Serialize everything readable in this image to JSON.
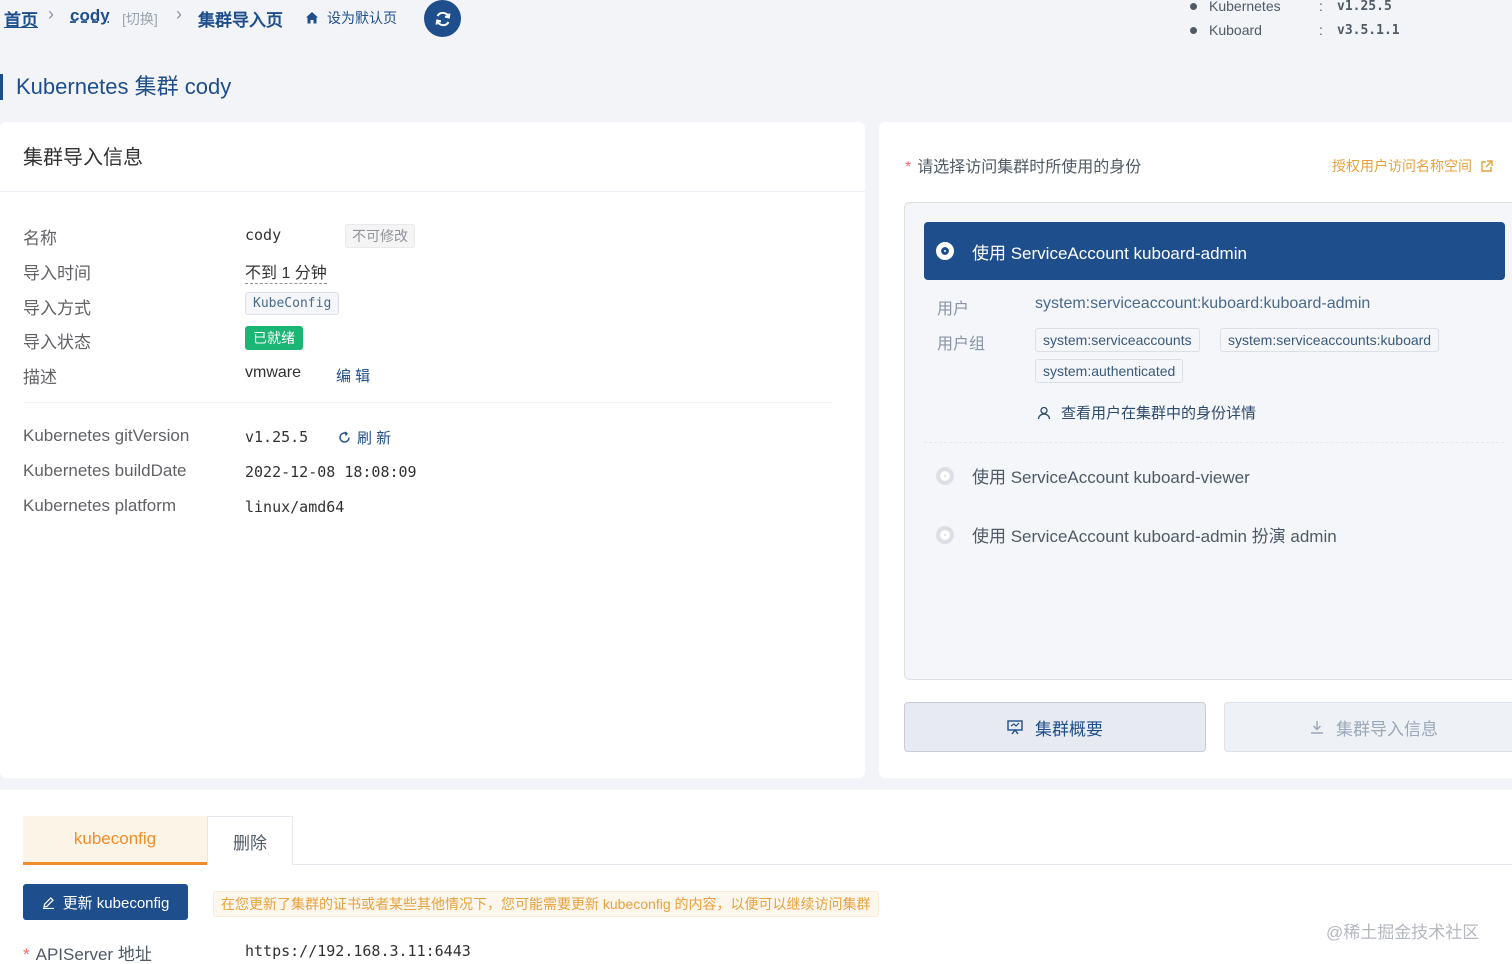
{
  "breadcrumb": {
    "home": "首页",
    "cluster": "cody",
    "switch": "[切换]",
    "current": "集群导入页",
    "set_default": "设为默认页"
  },
  "versions": [
    {
      "name": "Kubernetes",
      "sep": ":",
      "value": "v1.25.5"
    },
    {
      "name": "Kuboard",
      "sep": ":",
      "value": "v3.5.1.1"
    }
  ],
  "page_title": "Kubernetes 集群 cody",
  "import_info": {
    "title": "集群导入信息",
    "name_label": "名称",
    "name_value": "cody",
    "name_tag": "不可修改",
    "time_label": "导入时间",
    "time_value": "不到 1 分钟",
    "method_label": "导入方式",
    "method_value": "KubeConfig",
    "status_label": "导入状态",
    "status_value": "已就绪",
    "desc_label": "描述",
    "desc_value": "vmware",
    "edit_link": "编 辑",
    "git_label": "Kubernetes gitVersion",
    "git_value": "v1.25.5",
    "refresh_link": "刷 新",
    "build_label": "Kubernetes buildDate",
    "build_value": "2022-12-08 18:08:09",
    "platform_label": "Kubernetes platform",
    "platform_value": "linux/amd64"
  },
  "identity": {
    "required_label": "请选择访问集群时所使用的身份",
    "auth_link": "授权用户访问名称空间",
    "selected_option": "使用 ServiceAccount kuboard-admin",
    "user_label": "用户",
    "user_value": "system:serviceaccount:kuboard:kuboard-admin",
    "group_label": "用户组",
    "groups": [
      "system:serviceaccounts",
      "system:serviceaccounts:kuboard",
      "system:authenticated"
    ],
    "detail_link": "查看用户在集群中的身份详情",
    "option_viewer": "使用 ServiceAccount kuboard-viewer",
    "option_impersonate": "使用 ServiceAccount kuboard-admin 扮演 admin"
  },
  "actions": {
    "overview": "集群概要",
    "import_info": "集群导入信息"
  },
  "tabs": {
    "kubeconfig": "kubeconfig",
    "delete": "删除"
  },
  "kubeconfig": {
    "update_button": "更新 kubeconfig",
    "warning": "在您更新了集群的证书或者某些其他情况下，您可能需要更新 kubeconfig 的内容，以便可以继续访问集群",
    "api_label": "APIServer 地址",
    "api_value": "https://192.168.3.11:6443"
  },
  "watermark": "@稀土掘金技术社区",
  "colors": {
    "primary": "#1f4e8c",
    "success": "#1bb574",
    "warning": "#e6a23c",
    "tab_active": "#f28c28"
  }
}
